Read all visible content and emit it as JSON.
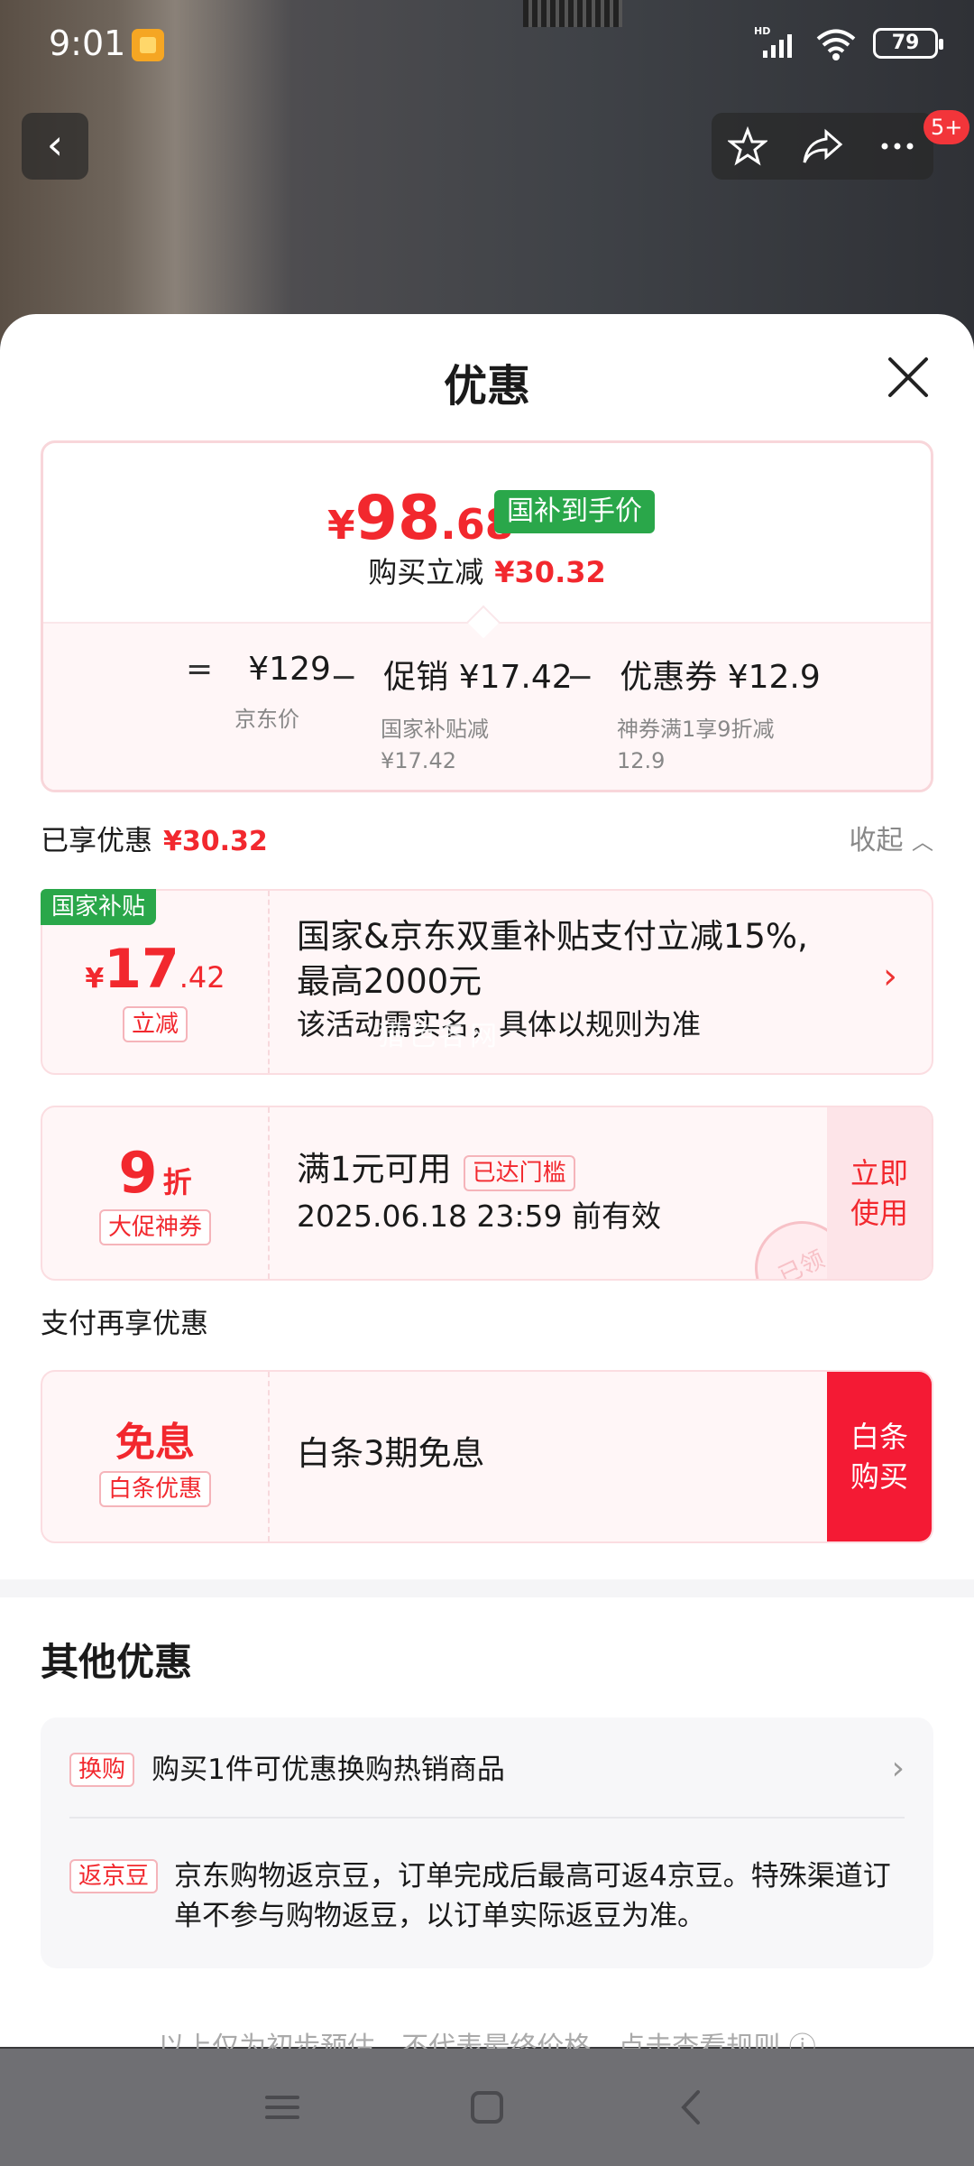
{
  "status_bar": {
    "time": "9:01",
    "hd": "HD",
    "battery": "79"
  },
  "nav": {
    "badge": "5+"
  },
  "sheet": {
    "title": "优惠"
  },
  "price_card": {
    "yen": "¥",
    "price_int": "98",
    "price_dec": ".68",
    "subsidy_tag": "国补到手价",
    "reduce_label": "购买立减",
    "reduce_amount": "¥30.32",
    "formula": [
      {
        "op": "=",
        "amount": "¥129",
        "note": "京东价"
      },
      {
        "op": "−",
        "amount": "促销 ¥17.42",
        "note": "国家补贴减\n¥17.42"
      },
      {
        "op": "−",
        "amount": "优惠券 ¥12.9",
        "note": "神券满1享9折减\n12.9"
      }
    ]
  },
  "enjoyed": {
    "label": "已享优惠",
    "amount": "¥30.32",
    "collapse": "收起"
  },
  "coupon1": {
    "corner": "国家补贴",
    "yen": "¥",
    "int": "17",
    "dec": ".42",
    "tag": "立减",
    "line1": "国家&京东双重补贴支付立减15%,",
    "line2": "最高2000元",
    "line3": "该活动需实名，具体以规则为准",
    "watermark": "猎色各网"
  },
  "coupon2": {
    "num": "9",
    "unit": "折",
    "tag": "大促神券",
    "title": "满1元可用",
    "badge": "已达门槛",
    "expire": "2025.06.18 23:59 前有效",
    "action": "立即使用",
    "stamp": "已领"
  },
  "pay_section": {
    "label": "支付再享优惠"
  },
  "coupon3": {
    "title": "免息",
    "tag": "白条优惠",
    "text": "白条3期免息",
    "action": "白条购买"
  },
  "other": {
    "title": "其他优惠",
    "items": [
      {
        "tag": "换购",
        "text": "购买1件可优惠换购热销商品"
      },
      {
        "tag": "返京豆",
        "text": "京东购物返京豆，订单完成后最高可返4京豆。特殊渠道订单不参与购物返豆，以订单实际返豆为准。"
      }
    ]
  },
  "footnote": "以上仅为初步预估，不代表最终价格，点击查看规则 ⓘ"
}
